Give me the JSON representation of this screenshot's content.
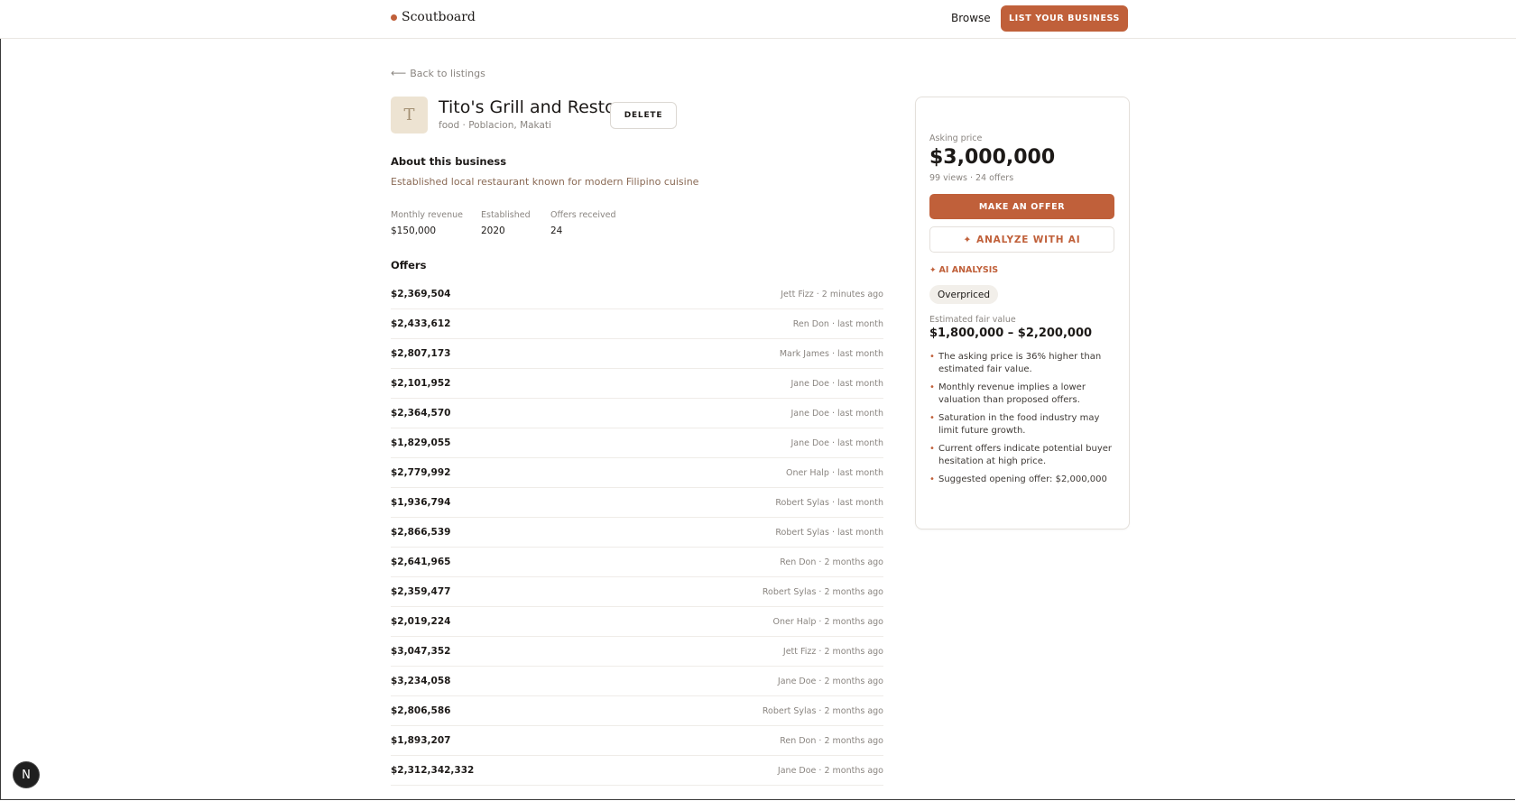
{
  "header": {
    "logo": "Scoutboard",
    "nav_browse": "Browse",
    "list_button": "LIST YOUR BUSINESS"
  },
  "back_link": "Back to listings",
  "listing": {
    "avatar_letter": "T",
    "title": "Tito's Grill and Resto",
    "subtitle": "food · Poblacion, Makati",
    "delete_label": "DELETE",
    "about_heading": "About this business",
    "about_text": "Established local restaurant known for modern Filipino cuisine",
    "stats": [
      {
        "label": "Monthly revenue",
        "value": "$150,000"
      },
      {
        "label": "Established",
        "value": "2020"
      },
      {
        "label": "Offers received",
        "value": "24"
      }
    ],
    "offers_heading": "Offers",
    "offers": [
      {
        "amount": "$2,369,504",
        "meta": "Jett Fizz · 2 minutes ago"
      },
      {
        "amount": "$2,433,612",
        "meta": "Ren Don · last month"
      },
      {
        "amount": "$2,807,173",
        "meta": "Mark James · last month"
      },
      {
        "amount": "$2,101,952",
        "meta": "Jane Doe · last month"
      },
      {
        "amount": "$2,364,570",
        "meta": "Jane Doe · last month"
      },
      {
        "amount": "$1,829,055",
        "meta": "Jane Doe · last month"
      },
      {
        "amount": "$2,779,992",
        "meta": "Oner Halp · last month"
      },
      {
        "amount": "$1,936,794",
        "meta": "Robert Sylas · last month"
      },
      {
        "amount": "$2,866,539",
        "meta": "Robert Sylas · last month"
      },
      {
        "amount": "$2,641,965",
        "meta": "Ren Don · 2 months ago"
      },
      {
        "amount": "$2,359,477",
        "meta": "Robert Sylas · 2 months ago"
      },
      {
        "amount": "$2,019,224",
        "meta": "Oner Halp · 2 months ago"
      },
      {
        "amount": "$3,047,352",
        "meta": "Jett Fizz · 2 months ago"
      },
      {
        "amount": "$3,234,058",
        "meta": "Jane Doe · 2 months ago"
      },
      {
        "amount": "$2,806,586",
        "meta": "Robert Sylas · 2 months ago"
      },
      {
        "amount": "$1,893,207",
        "meta": "Ren Don · 2 months ago"
      },
      {
        "amount": "$2,312,342,332",
        "meta": "Jane Doe · 2 months ago"
      }
    ]
  },
  "sidebar": {
    "asking_label": "Asking price",
    "asking_price": "$3,000,000",
    "meta": "99 views · 24 offers",
    "offer_button": "MAKE AN OFFER",
    "analyze_button": "ANALYZE WITH AI",
    "ai_label": "AI ANALYSIS",
    "verdict": "Overpriced",
    "fair_label": "Estimated fair value",
    "fair_value": "$1,800,000 – $2,200,000",
    "points": [
      "The asking price is 36% higher than estimated fair value.",
      "Monthly revenue implies a lower valuation than proposed offers.",
      "Saturation in the food industry may limit future growth.",
      "Current offers indicate potential buyer hesitation at high price.",
      "Suggested opening offer: $2,000,000"
    ]
  },
  "dev_badge": "N",
  "colors": {
    "accent": "#c0603a",
    "text": "#1c1917",
    "muted": "#8a8580",
    "avatar_bg": "#ede3d2"
  }
}
